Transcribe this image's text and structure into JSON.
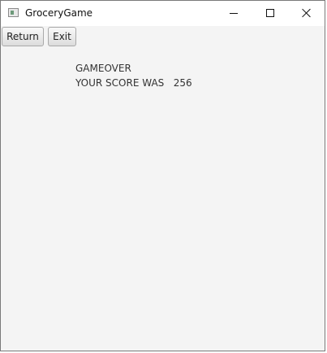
{
  "window": {
    "title": "GroceryGame",
    "icon": "app-window-icon"
  },
  "toolbar": {
    "return_label": "Return",
    "exit_label": "Exit"
  },
  "game_over": {
    "heading": "GAMEOVER",
    "score_label": "YOUR SCORE WAS",
    "score_value": "256"
  },
  "colors": {
    "background": "#f4f4f4",
    "titlebar": "#ffffff",
    "text": "#333333"
  }
}
